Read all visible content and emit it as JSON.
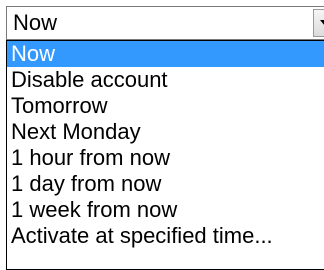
{
  "combo": {
    "value": "Now",
    "button_icon": "chevron-down-icon"
  },
  "dropdown": {
    "selected_index": 0,
    "selected_color": "#3399ff",
    "options": [
      "Now",
      "Disable account",
      "Tomorrow",
      "Next Monday",
      "1 hour from now",
      "1 day from now",
      "1 week from now",
      "Activate at specified time..."
    ]
  }
}
